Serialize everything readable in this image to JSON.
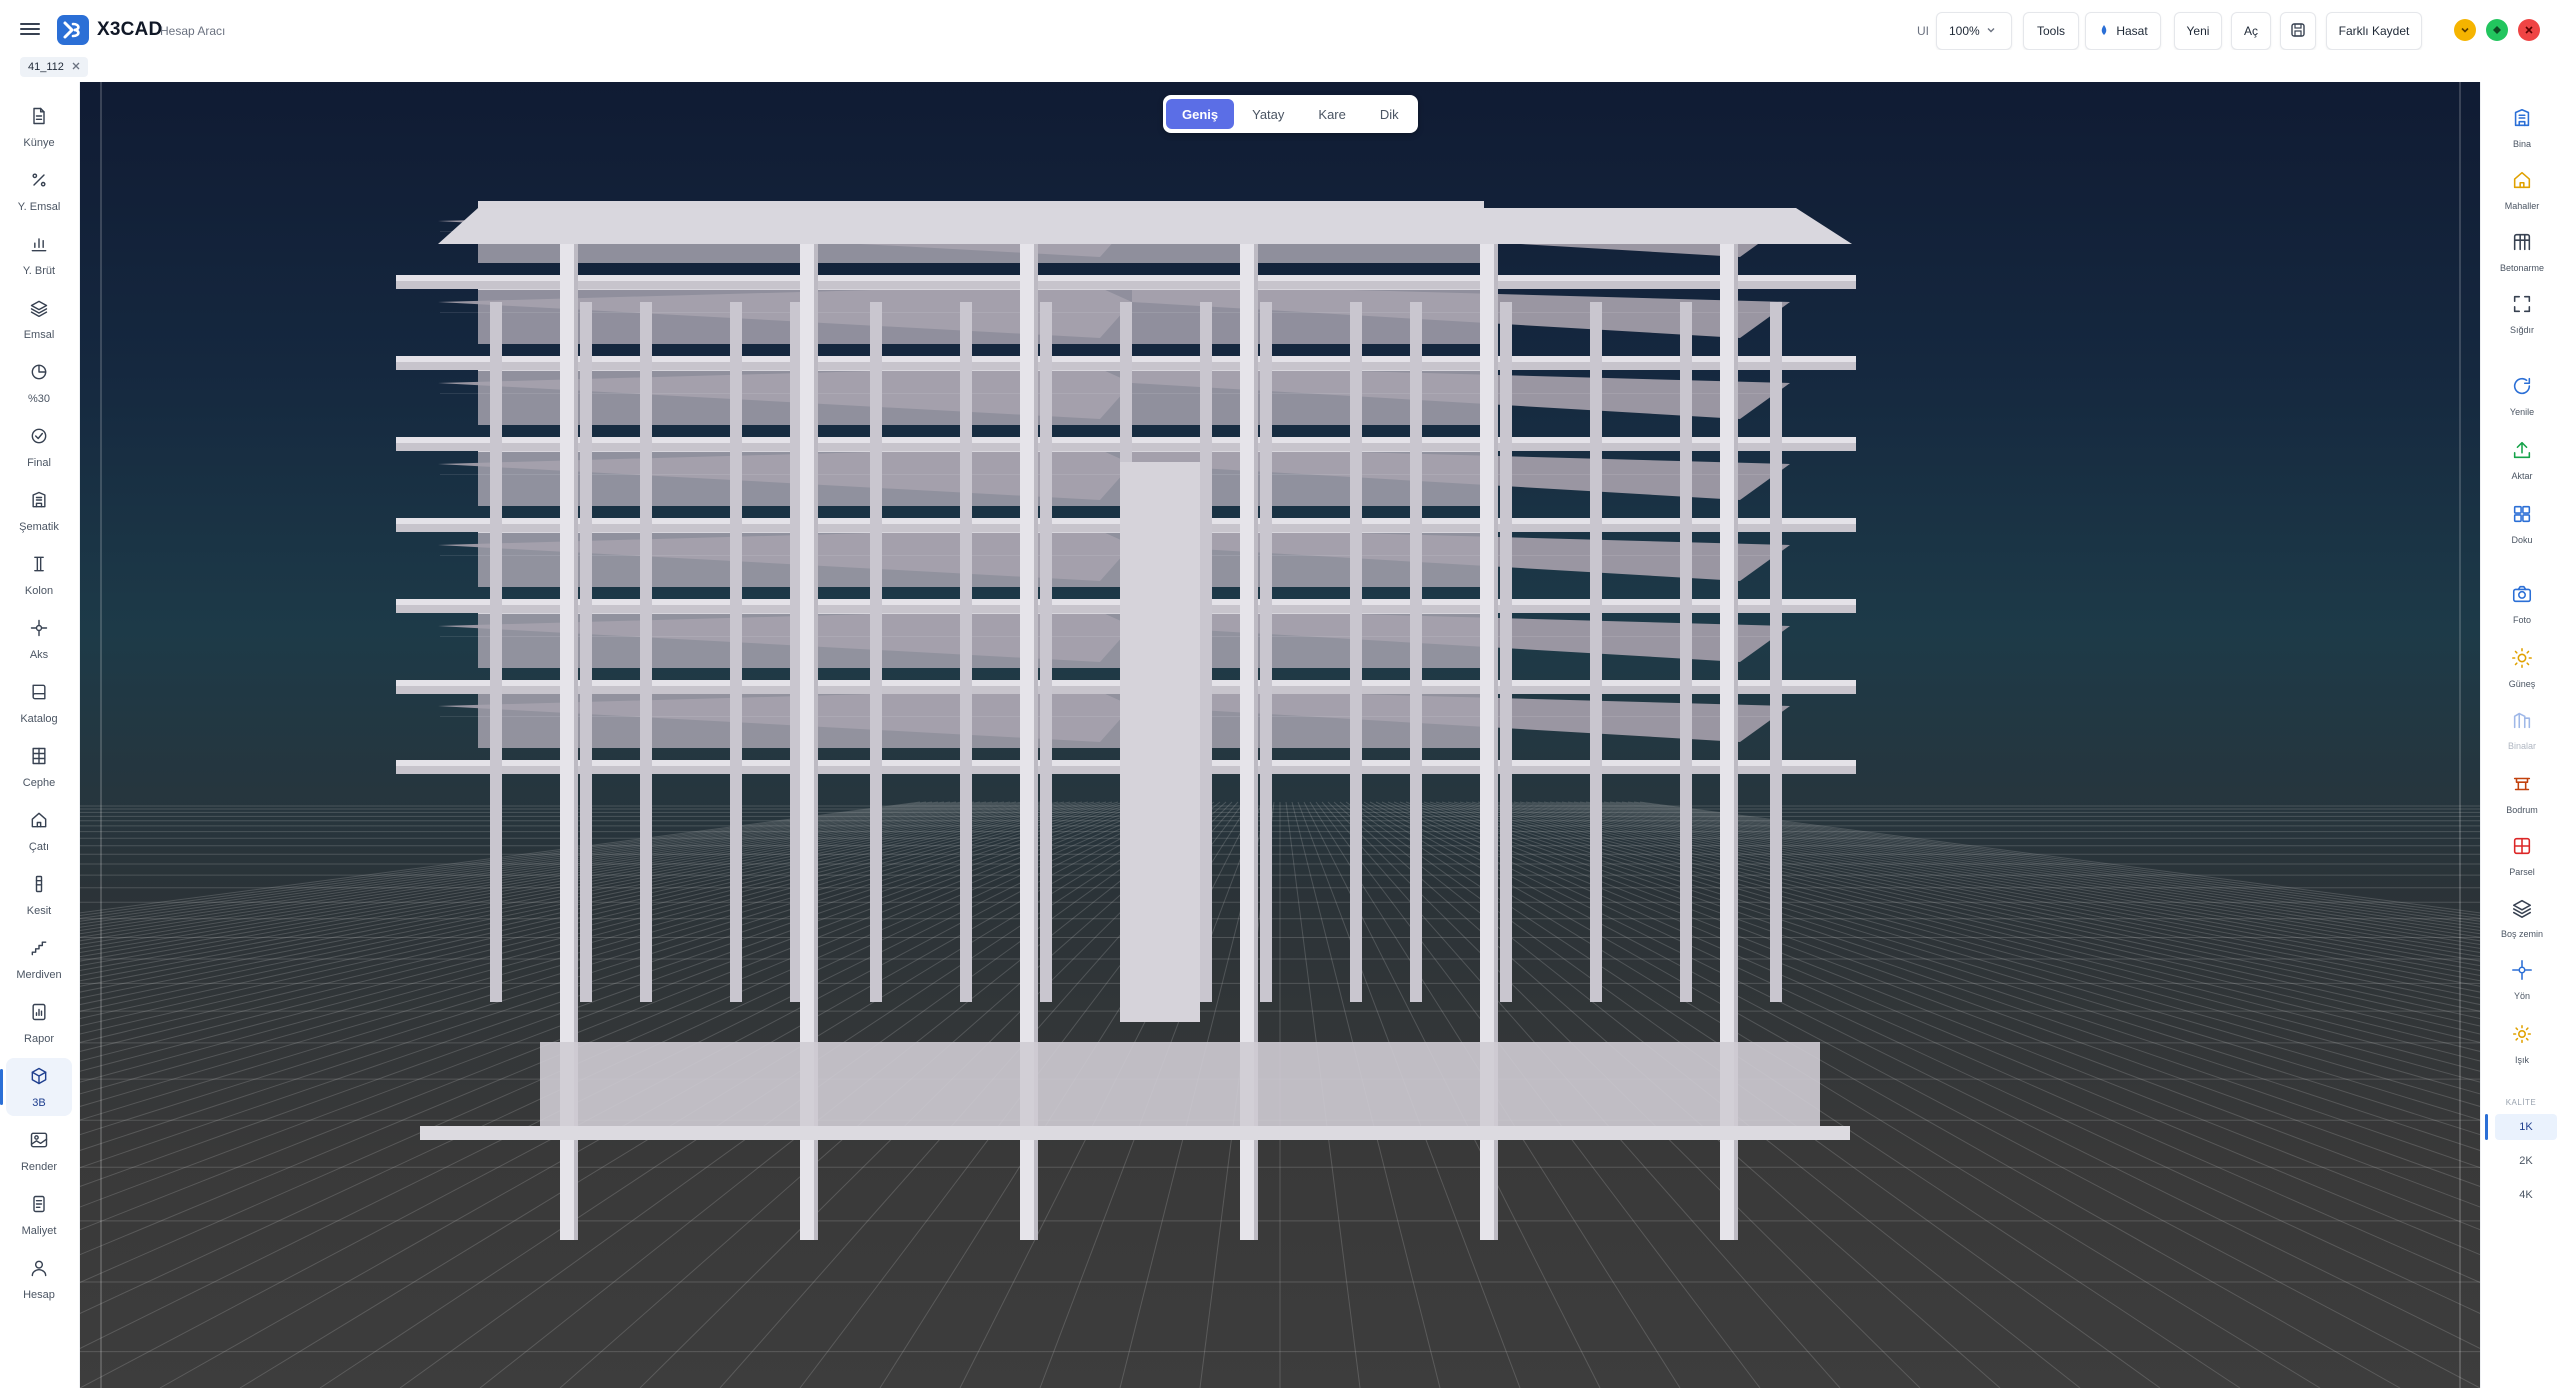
{
  "app": {
    "brand": "X3CAD",
    "brand_sub": "Hesap Aracı"
  },
  "toolbar": {
    "ui_label": "UI",
    "zoom": "100%",
    "tools": "Tools",
    "hasat": "Hasat",
    "yeni": "Yeni",
    "ac": "Aç",
    "save_as": "Farklı Kaydet"
  },
  "document_tab": {
    "label": "41_112"
  },
  "left_nav": [
    {
      "label": "Künye",
      "icon": "document-icon"
    },
    {
      "label": "Y. Emsal",
      "icon": "percent-icon"
    },
    {
      "label": "Y. Brüt",
      "icon": "bar-chart-icon"
    },
    {
      "label": "Emsal",
      "icon": "layers-icon"
    },
    {
      "label": "%30",
      "icon": "clock-pie-icon"
    },
    {
      "label": "Final",
      "icon": "check-circle-icon"
    },
    {
      "label": "Şematik",
      "icon": "building-icon"
    },
    {
      "label": "Kolon",
      "icon": "column-icon"
    },
    {
      "label": "Aks",
      "icon": "crosshair-icon"
    },
    {
      "label": "Katalog",
      "icon": "book-icon"
    },
    {
      "label": "Cephe",
      "icon": "facade-icon"
    },
    {
      "label": "Çatı",
      "icon": "home-icon"
    },
    {
      "label": "Kesit",
      "icon": "section-icon"
    },
    {
      "label": "Merdiven",
      "icon": "stairs-icon"
    },
    {
      "label": "Rapor",
      "icon": "report-icon"
    },
    {
      "label": "3B",
      "icon": "cube-icon"
    },
    {
      "label": "Render",
      "icon": "image-icon"
    },
    {
      "label": "Maliyet",
      "icon": "receipt-icon"
    },
    {
      "label": "Hesap",
      "icon": "user-icon"
    }
  ],
  "left_nav_active": "3B",
  "right_nav": [
    {
      "label": "Bina",
      "icon": "building-icon",
      "color": "#2b6fd6"
    },
    {
      "label": "Mahaller",
      "icon": "home-icon",
      "color": "#e0a100"
    },
    {
      "label": "Betonarme",
      "icon": "grid-icon",
      "color": "#374151"
    },
    {
      "label": "Sığdır",
      "icon": "fit-icon",
      "color": "#374151"
    },
    {
      "label": "Yenile",
      "icon": "refresh-icon",
      "color": "#2b6fd6"
    },
    {
      "label": "Aktar",
      "icon": "upload-icon",
      "color": "#16a34a"
    },
    {
      "label": "Doku",
      "icon": "texture-icon",
      "color": "#2b6fd6"
    },
    {
      "label": "Foto",
      "icon": "camera-icon",
      "color": "#2b6fd6"
    },
    {
      "label": "Güneş",
      "icon": "sun-icon",
      "color": "#e0a100"
    },
    {
      "label": "Binalar",
      "icon": "buildings-icon",
      "color": "#9fb8e8"
    },
    {
      "label": "Bodrum",
      "icon": "basement-icon",
      "color": "#c2410c"
    },
    {
      "label": "Parsel",
      "icon": "parcel-icon",
      "color": "#dc2626"
    },
    {
      "label": "Boş zemin",
      "icon": "layers-icon",
      "color": "#374151"
    },
    {
      "label": "Yön",
      "icon": "compass-icon",
      "color": "#2b6fd6"
    },
    {
      "label": "Işık",
      "icon": "light-icon",
      "color": "#e0a100"
    }
  ],
  "quality": {
    "title": "KALİTE",
    "options": [
      "1K",
      "2K",
      "4K"
    ],
    "selected": "1K"
  },
  "view_modes": {
    "options": [
      "Geniş",
      "Yatay",
      "Kare",
      "Dik"
    ],
    "selected": "Geniş"
  },
  "colors": {
    "accent": "#2b6fd6",
    "segment_active": "#5b6ee6",
    "win_yellow": "#f5b400",
    "win_green": "#22c55e",
    "win_red": "#ef4444"
  }
}
